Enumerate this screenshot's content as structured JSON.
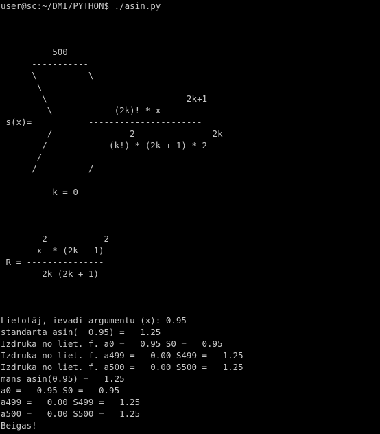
{
  "terminal": {
    "prompt": "user@sc:~/DMI/PYTHON$ ./asin.py",
    "formula_s": [
      "          500",
      "      -----------",
      "      \\          \\",
      "       \\",
      "        \\                           2k+1",
      "         \\            (2k)! * x",
      " s(x)=           ----------------------",
      "         /               2               2k",
      "        /            (k!) * (2k + 1) * 2",
      "       /",
      "      /          /",
      "      -----------",
      "          k = 0"
    ],
    "formula_r": [
      "        2           2",
      "       x  * (2k - 1)",
      " R = ---------------",
      "        2k (2k + 1)"
    ],
    "output": [
      "Lietotāj, ievadi argumentu (x): 0.95",
      "standarta asin(  0.95) =   1.25",
      "Izdruka no liet. f. a0 =   0.95 S0 =   0.95",
      "Izdruka no liet. f. a499 =   0.00 S499 =   1.25",
      "Izdruka no liet. f. a500 =   0.00 S500 =   1.25",
      "mans asin(0.95) =   1.25",
      "a0 =   0.95 S0 =   0.95",
      "a499 =   0.00 S499 =   1.25",
      "a500 =   0.00 S500 =   1.25",
      "Beigas!"
    ],
    "colors": {
      "background": "#000000",
      "text": "#c8c8c8"
    }
  }
}
